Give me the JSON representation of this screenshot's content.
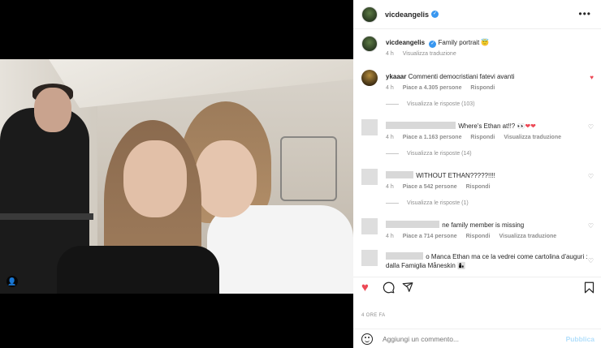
{
  "post": {
    "username": "vicdeangelis",
    "caption": "Family portrait",
    "caption_emoji": "😇",
    "caption_time": "4 h",
    "caption_translate": "Visualizza traduzione",
    "date": "4 ORE FA"
  },
  "comments": [
    {
      "username": "ykaaar",
      "text": "Commenti democristiani fatevi avanti",
      "time": "4 h",
      "likes": "Piace a 4.305 persone",
      "reply": "Rispondi",
      "replies": "Visualizza le risposte (103)",
      "liked": true
    },
    {
      "text": "Where's Ethan at!!?",
      "emoji": "👀❤❤",
      "time": "4 h",
      "likes": "Piace a 1.163 persone",
      "reply": "Rispondi",
      "translate": "Visualizza traduzione",
      "replies": "Visualizza le risposte (14)"
    },
    {
      "text": "WITHOUT ETHAN?????!!!!",
      "time": "4 h",
      "likes": "Piace a 542 persone",
      "reply": "Rispondi",
      "replies": "Visualizza le risposte (1)"
    },
    {
      "text": "ne family member is missing",
      "time": "4 h",
      "likes": "Piace a 714 persone",
      "reply": "Rispondi",
      "translate": "Visualizza traduzione"
    },
    {
      "text_prefix": "o",
      "text": "Manca Ethan ma ce la vedrei come cartolina d'auguri : dalla Famiglia Måneskin",
      "emoji": "👩‍👦"
    }
  ],
  "actions": {
    "like_icon": "heart-icon",
    "comment_icon": "comment-icon",
    "share_icon": "share-icon",
    "save_icon": "bookmark-icon"
  },
  "composer": {
    "placeholder": "Aggiungi un commento...",
    "post_label": "Pubblica"
  },
  "colors": {
    "verified": "#3897f0",
    "liked": "#ed4956",
    "post_disabled": "#b2dffc"
  }
}
